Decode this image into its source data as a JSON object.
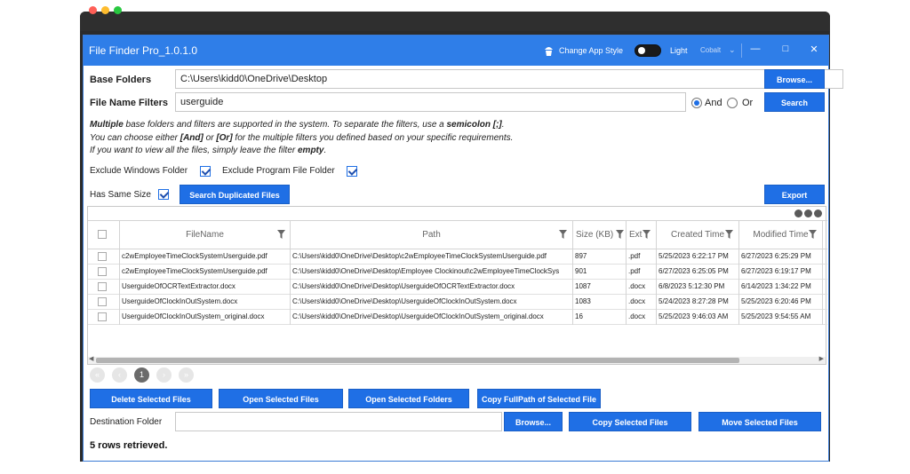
{
  "app": {
    "title": "File Finder Pro_1.0.1.0",
    "change_style_label": "Change App Style",
    "theme_label": "Light",
    "theme_color": "Cobalt",
    "accent": "#1f6fe5"
  },
  "form": {
    "base_folders_label": "Base Folders",
    "base_folders_value": "C:\\Users\\kidd0\\OneDrive\\Desktop",
    "browse_label": "Browse...",
    "filters_label": "File Name Filters",
    "filters_value": "userguide",
    "and_label": "And",
    "or_label": "Or",
    "search_label": "Search"
  },
  "info": {
    "line1_a": "Multiple",
    "line1_b": " base folders and filters are supported in the system. To separate the filters, use a ",
    "line1_c": "semicolon [;]",
    "line1_d": ".",
    "line2_a": "You can choose either ",
    "line2_b": "[And]",
    "line2_c": " or ",
    "line2_d": "[Or]",
    "line2_e": " for the multiple filters you defined based on your specific requirements.",
    "line3_a": "If you want to view all the files, simply leave the filter ",
    "line3_b": "empty",
    "line3_c": "."
  },
  "options": {
    "exclude_windows": "Exclude Windows Folder",
    "exclude_program": "Exclude Program File Folder",
    "same_size": "Has Same Size",
    "search_dup": "Search Duplicated Files",
    "export": "Export"
  },
  "table": {
    "columns": [
      "FileName",
      "Path",
      "Size (KB)",
      "Ext",
      "Created Time",
      "Modified Time"
    ],
    "rows": [
      [
        "c2wEmployeeTimeClockSystemUserguide.pdf",
        "C:\\Users\\kidd0\\OneDrive\\Desktop\\c2wEmployeeTimeClockSystemUserguide.pdf",
        "897",
        ".pdf",
        "5/25/2023 6:22:17 PM",
        "6/27/2023 6:25:29 PM"
      ],
      [
        "c2wEmployeeTimeClockSystemUserguide.pdf",
        "C:\\Users\\kidd0\\OneDrive\\Desktop\\Employee Clockinout\\c2wEmployeeTimeClockSys",
        "901",
        ".pdf",
        "6/27/2023 6:25:05 PM",
        "6/27/2023 6:19:17 PM"
      ],
      [
        "UserguideOfOCRTextExtractor.docx",
        "C:\\Users\\kidd0\\OneDrive\\Desktop\\UserguideOfOCRTextExtractor.docx",
        "1087",
        ".docx",
        "6/8/2023 5:12:30 PM",
        "6/14/2023 1:34:22 PM"
      ],
      [
        "UserguideOfClockInOutSystem.docx",
        "C:\\Users\\kidd0\\OneDrive\\Desktop\\UserguideOfClockInOutSystem.docx",
        "1083",
        ".docx",
        "5/24/2023 8:27:28 PM",
        "5/25/2023 6:20:46 PM"
      ],
      [
        "UserguideOfClockInOutSystem_original.docx",
        "C:\\Users\\kidd0\\OneDrive\\Desktop\\UserguideOfClockInOutSystem_original.docx",
        "16",
        ".docx",
        "5/25/2023 9:46:03 AM",
        "5/25/2023 9:54:55 AM"
      ]
    ]
  },
  "pager": {
    "current": "1"
  },
  "actions": {
    "delete": "Delete Selected Files",
    "open_files": "Open Selected Files",
    "open_folders": "Open Selected Folders",
    "copy_path": "Copy FullPath of Selected File",
    "dest_label": "Destination Folder",
    "dest_browse": "Browse...",
    "copy_files": "Copy Selected Files",
    "move_files": "Move Selected Files"
  },
  "status": "5 rows retrieved."
}
